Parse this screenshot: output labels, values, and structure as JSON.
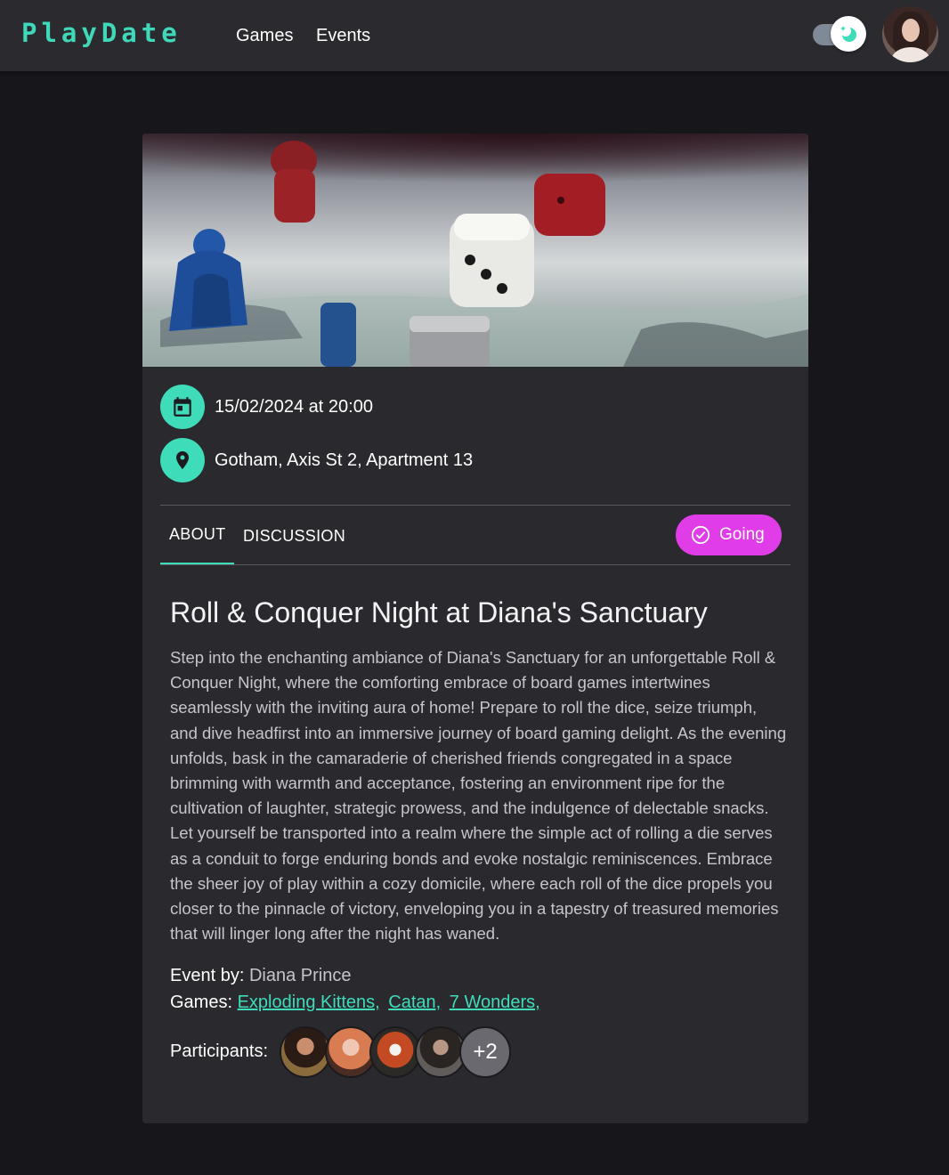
{
  "header": {
    "logo": "PlayDate",
    "nav": [
      {
        "label": "Games"
      },
      {
        "label": "Events"
      }
    ],
    "theme_mode": "dark"
  },
  "event": {
    "datetime": "15/02/2024 at 20:00",
    "location": "Gotham, Axis St 2, Apartment 13",
    "tabs": [
      {
        "label": "ABOUT",
        "active": true
      },
      {
        "label": "DISCUSSION",
        "active": false
      }
    ],
    "rsvp_label": "Going",
    "title": "Roll & Conquer Night at Diana's Sanctuary",
    "description": "Step into the enchanting ambiance of Diana's Sanctuary for an unforgettable Roll & Conquer Night, where the comforting embrace of board games intertwines seamlessly with the inviting aura of home! Prepare to roll the dice, seize triumph, and dive headfirst into an immersive journey of board gaming delight. As the evening unfolds, bask in the camaraderie of cherished friends congregated in a space brimming with warmth and acceptance, fostering an environment ripe for the cultivation of laughter, strategic prowess, and the indulgence of delectable snacks. Let yourself be transported into a realm where the simple act of rolling a die serves as a conduit to forge enduring bonds and evoke nostalgic reminiscences. Embrace the sheer joy of play within a cozy domicile, where each roll of the dice propels you closer to the pinnacle of victory, enveloping you in a tapestry of treasured memories that will linger long after the night has waned.",
    "by_label": "Event by:",
    "organizer": "Diana Prince",
    "games_label": "Games:",
    "games": [
      "Exploding Kittens,",
      "Catan,",
      "7 Wonders,"
    ],
    "participants_label": "Participants:",
    "participants_more": "+2"
  },
  "colors": {
    "accent": "#3fdcba",
    "rsvp": "#e03ce8",
    "card": "#2a292e",
    "background": "#17161b"
  },
  "icons": {
    "date": "calendar-icon",
    "location": "map-pin-icon",
    "rsvp": "check-circle-icon",
    "theme": "moon-icon"
  }
}
